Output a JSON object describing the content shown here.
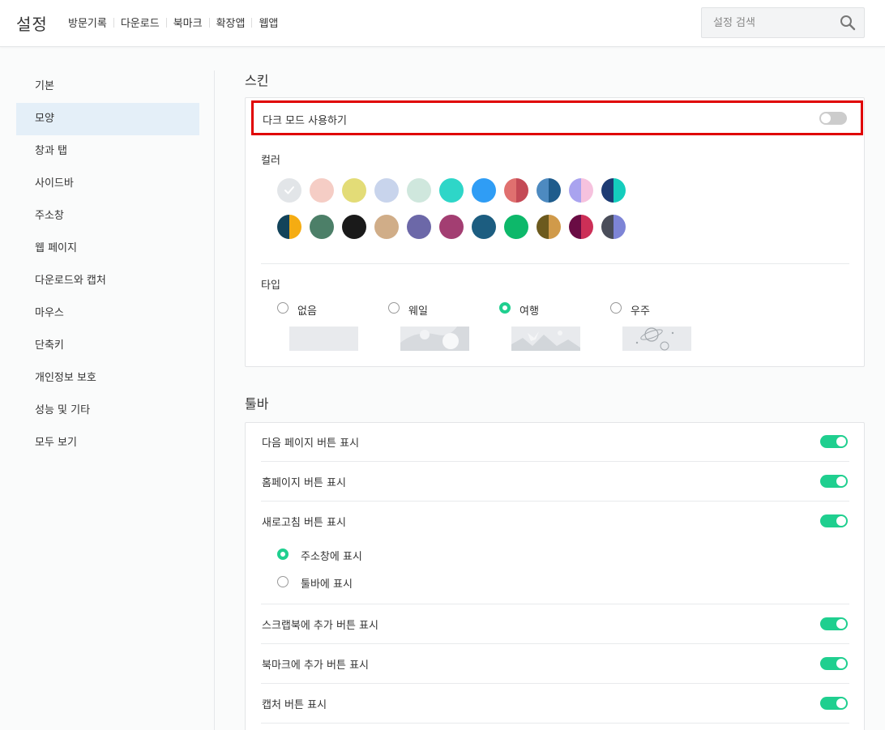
{
  "header": {
    "title": "설정",
    "nav": [
      "방문기록",
      "다운로드",
      "북마크",
      "확장앱",
      "웹앱"
    ],
    "search_placeholder": "설정 검색"
  },
  "sidebar": {
    "items": [
      "기본",
      "모양",
      "창과 탭",
      "사이드바",
      "주소창",
      "웹 페이지",
      "다운로드와 캡처",
      "마우스",
      "단축키",
      "개인정보 보호",
      "성능 및 기타",
      "모두 보기"
    ],
    "active_index": 1
  },
  "skin": {
    "title": "스킨",
    "dark_mode_label": "다크 모드 사용하기",
    "dark_mode_on": false,
    "color_label": "컬러",
    "colors_row1": [
      [
        "#e2e5e8",
        "#e2e5e8"
      ],
      [
        "#f5cdc5",
        "#f5cdc5"
      ],
      [
        "#e3dc77",
        "#e3dc77"
      ],
      [
        "#c8d4ec",
        "#c8d4ec"
      ],
      [
        "#cfe7dd",
        "#cfe7dd"
      ],
      [
        "#2ed6c8",
        "#2ed6c8"
      ],
      [
        "#2f9df5",
        "#2f9df5"
      ],
      [
        "#e0706f",
        "#c44a56"
      ],
      [
        "#4d8ac0",
        "#1f5c8c"
      ],
      [
        "#a9a3ef",
        "#f6c2de"
      ],
      [
        "#1d3b73",
        "#14cdbd"
      ]
    ],
    "colors_row2": [
      [
        "#12435a",
        "#f5ac12"
      ],
      [
        "#4c7f68",
        "#4c7f68"
      ],
      [
        "#1a1a1a",
        "#1a1a1a"
      ],
      [
        "#d0ad88",
        "#d0ad88"
      ],
      [
        "#6c68a8",
        "#6c68a8"
      ],
      [
        "#a33e72",
        "#a33e72"
      ],
      [
        "#1c5d80",
        "#1c5d80"
      ],
      [
        "#0db86a",
        "#0db86a"
      ],
      [
        "#6c5a1e",
        "#d09a4a"
      ],
      [
        "#6a0c44",
        "#cc2f57"
      ],
      [
        "#4a4d5a",
        "#7d84d6"
      ]
    ],
    "type_label": "타입",
    "types": [
      "없음",
      "웨일",
      "여행",
      "우주"
    ],
    "selected_type": 2
  },
  "toolbar": {
    "title": "툴바",
    "rows": [
      {
        "label": "다음 페이지 버튼 표시",
        "on": true
      },
      {
        "label": "홈페이지 버튼 표시",
        "on": true
      },
      {
        "label": "새로고침 버튼 표시",
        "on": true
      },
      {
        "label": "스크랩북에 추가 버튼 표시",
        "on": true
      },
      {
        "label": "북마크에 추가 버튼 표시",
        "on": true
      },
      {
        "label": "캡처 버튼 표시",
        "on": true
      }
    ],
    "refresh_options": [
      "주소창에 표시",
      "툴바에 표시"
    ],
    "refresh_selected": 0
  }
}
